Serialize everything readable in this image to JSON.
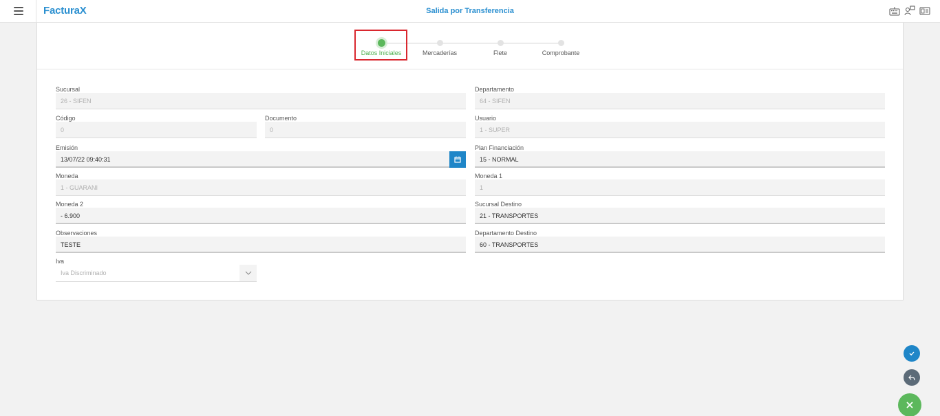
{
  "header": {
    "logo_text": "Factura",
    "logo_mark": "X",
    "title": "Salida por Transferencia",
    "icons": [
      "keyboard-icon",
      "users-icon",
      "card-reader-icon"
    ]
  },
  "stepper": {
    "steps": [
      {
        "label": "Datos Iniciales",
        "active": true
      },
      {
        "label": "Mercaderías",
        "active": false
      },
      {
        "label": "Flete",
        "active": false
      },
      {
        "label": "Comprobante",
        "active": false
      }
    ]
  },
  "form": {
    "sucursal": {
      "label": "Sucursal",
      "value": "26 - SIFEN"
    },
    "departamento": {
      "label": "Departamento",
      "value": "64 - SIFEN"
    },
    "codigo": {
      "label": "Código",
      "value": "0"
    },
    "documento": {
      "label": "Documento",
      "value": "0"
    },
    "usuario": {
      "label": "Usuario",
      "value": "1 - SUPER"
    },
    "emision": {
      "label": "Emisión",
      "value": "13/07/22 09:40:31"
    },
    "plan_financiacion": {
      "label": "Plan Financiación",
      "value": "15 - NORMAL"
    },
    "moneda": {
      "label": "Moneda",
      "value": "1 - GUARANI"
    },
    "moneda1": {
      "label": "Moneda 1",
      "value": "1"
    },
    "moneda2": {
      "label": "Moneda 2",
      "value": "- 6.900"
    },
    "sucursal_destino": {
      "label": "Sucursal Destino",
      "value": "21 - TRANSPORTES"
    },
    "observaciones": {
      "label": "Observaciones",
      "value": "TESTE"
    },
    "departamento_destino": {
      "label": "Departamento Destino",
      "value": "60 - TRANSPORTES"
    },
    "iva": {
      "label": "Iva",
      "value": "Iva Discriminado"
    }
  },
  "colors": {
    "accent": "#1f86c8",
    "step_active": "#5cb85c",
    "highlight": "#d9272e",
    "fab_confirm": "#1f86c8",
    "fab_back": "#5c6b78",
    "fab_close": "#5cb85c"
  }
}
